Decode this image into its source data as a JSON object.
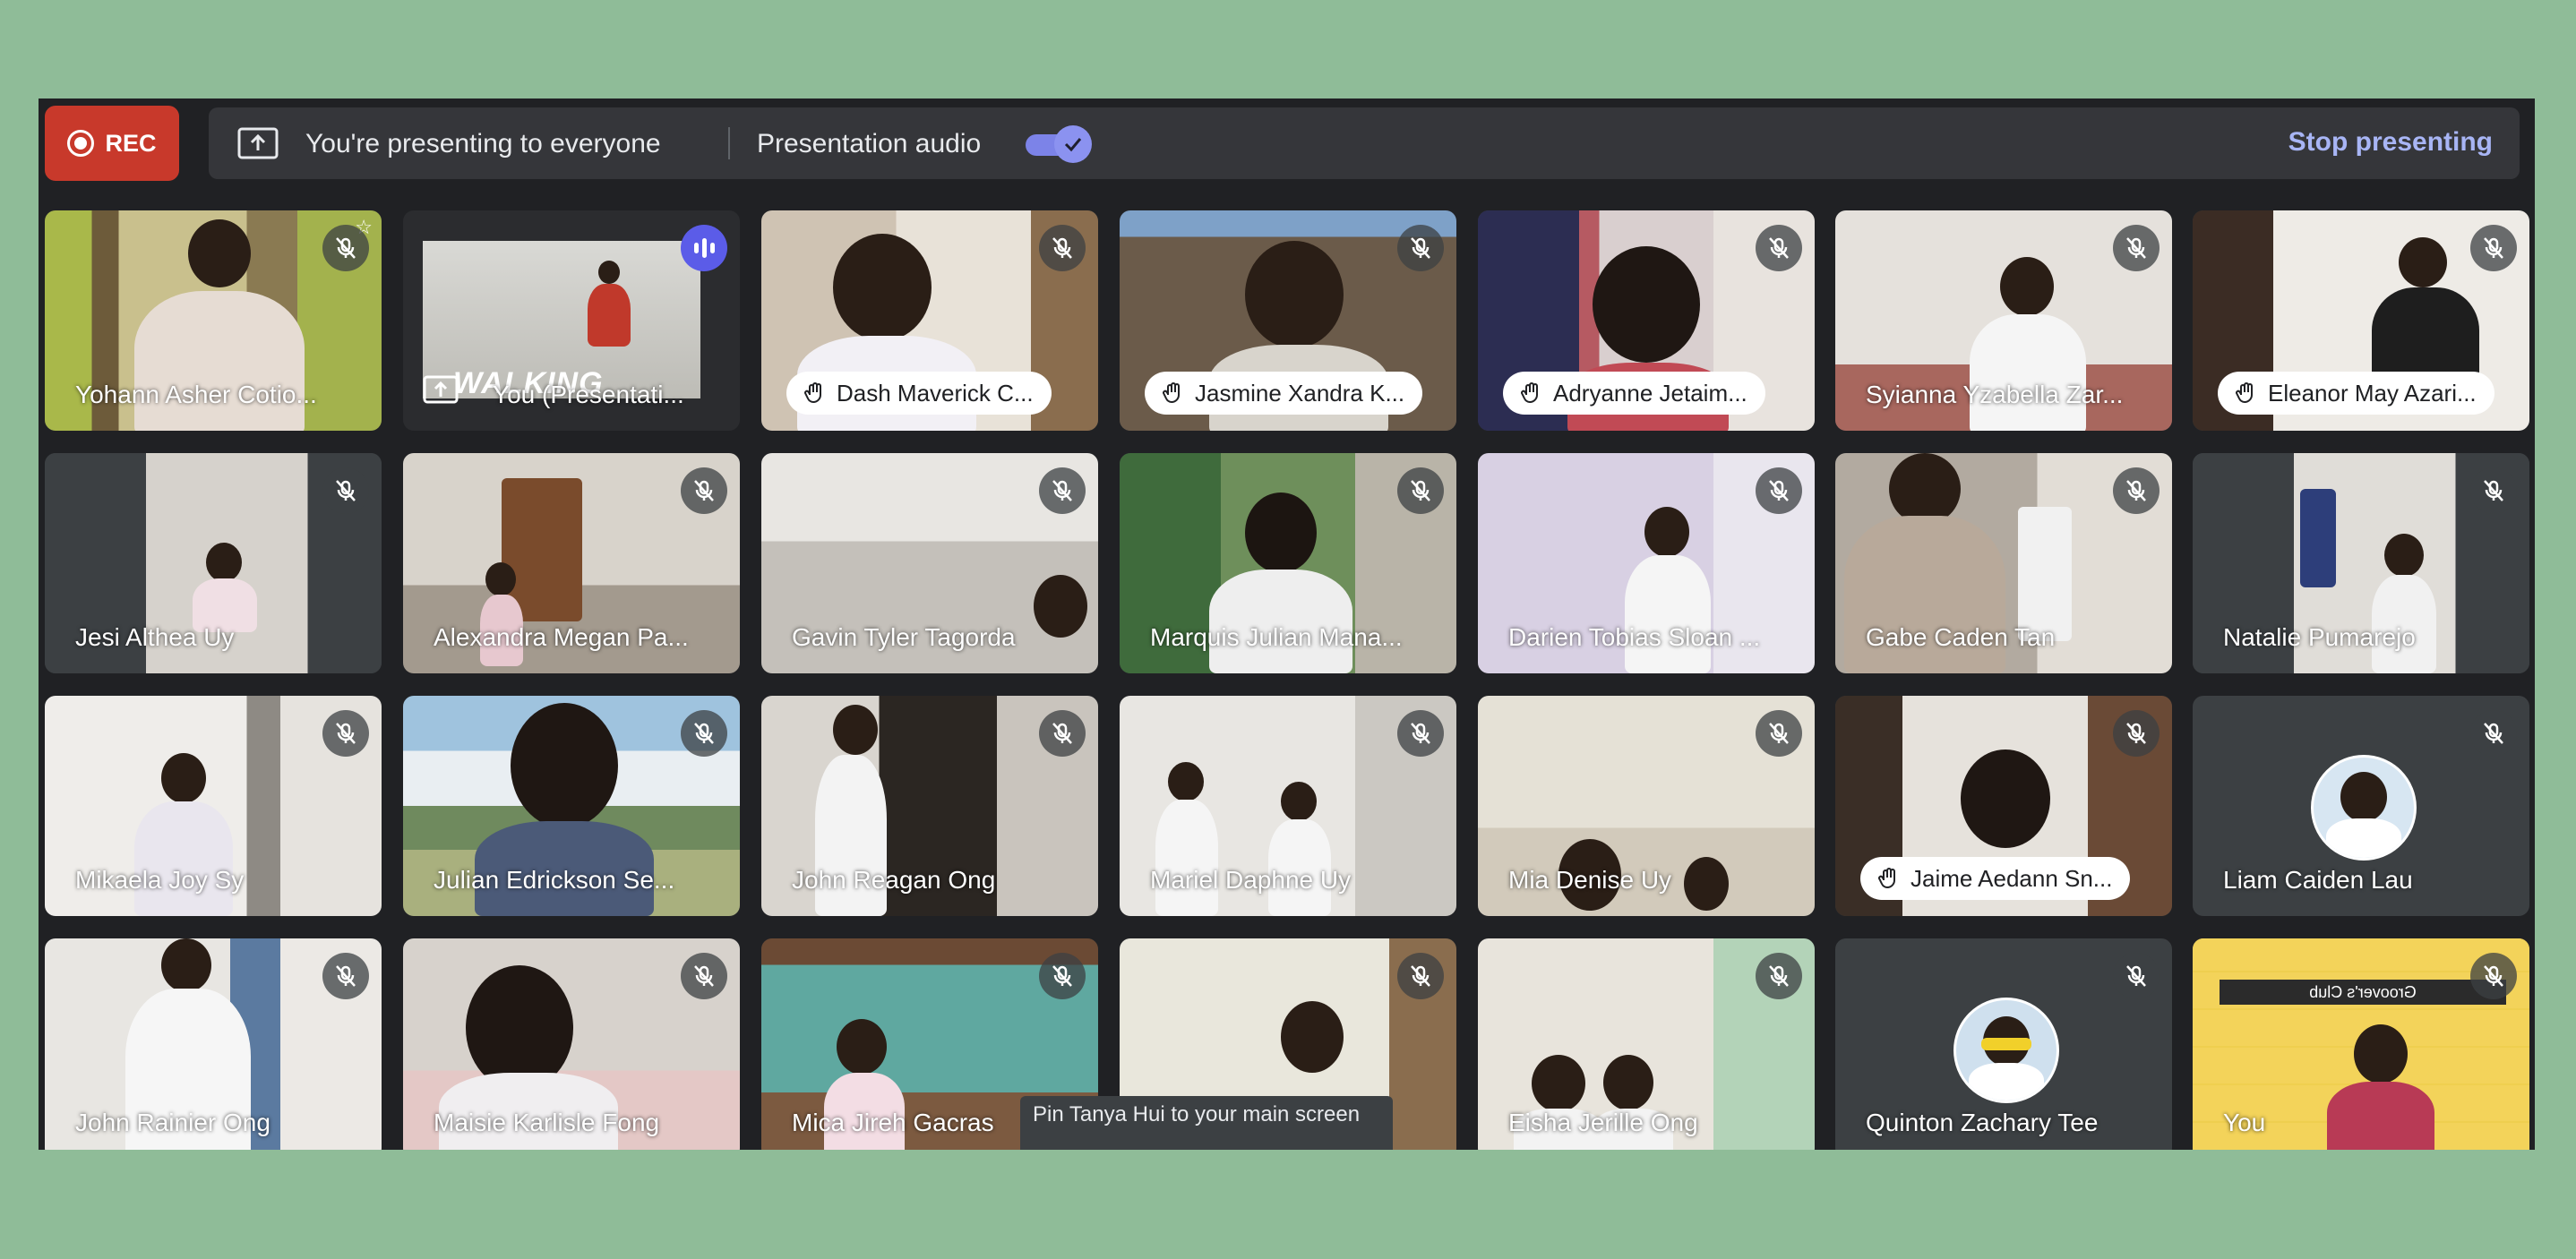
{
  "window": {
    "rec_label": "REC",
    "presenting_text": "You're presenting to everyone",
    "audio_label": "Presentation audio",
    "stop_label": "Stop presenting"
  },
  "tooltip": "Pin Tanya Hui to your main screen",
  "participants": [
    {
      "name": "Yohann Asher Cotio...",
      "style": "text",
      "muted": true
    },
    {
      "name": "You (Presentati...",
      "style": "text",
      "muted": false
    },
    {
      "name": "Dash Maverick C...",
      "style": "pill",
      "muted": true
    },
    {
      "name": "Jasmine Xandra K...",
      "style": "pill",
      "muted": true
    },
    {
      "name": "Adryanne Jetaim...",
      "style": "pill",
      "muted": true
    },
    {
      "name": "Syianna Yzabella Zar...",
      "style": "text",
      "muted": true
    },
    {
      "name": "Eleanor May Azari...",
      "style": "pill",
      "muted": true
    },
    {
      "name": "Jesi Althea Uy",
      "style": "text",
      "muted": true
    },
    {
      "name": "Alexandra Megan Pa...",
      "style": "text",
      "muted": true
    },
    {
      "name": "Gavin Tyler Tagorda",
      "style": "text",
      "muted": true
    },
    {
      "name": "Marquis Julian Mana...",
      "style": "text",
      "muted": true
    },
    {
      "name": "Darien Tobias Sloan ...",
      "style": "text",
      "muted": true
    },
    {
      "name": "Gabe Caden Tan",
      "style": "text",
      "muted": true
    },
    {
      "name": "Natalie Pumarejo",
      "style": "text",
      "muted": true
    },
    {
      "name": "Mikaela Joy Sy",
      "style": "text",
      "muted": true
    },
    {
      "name": "Julian Edrickson Se...",
      "style": "text",
      "muted": true
    },
    {
      "name": "John Reagan Ong",
      "style": "text",
      "muted": true
    },
    {
      "name": "Mariel Daphne Uy",
      "style": "text",
      "muted": true
    },
    {
      "name": "Mia Denise Uy",
      "style": "text",
      "muted": true
    },
    {
      "name": "Jaime Aedann Sn...",
      "style": "pill",
      "muted": true
    },
    {
      "name": "Liam Caiden Lau",
      "style": "text",
      "muted": true
    },
    {
      "name": "John Rainier Ong",
      "style": "text",
      "muted": true
    },
    {
      "name": "Maisie Karlisle Fong",
      "style": "text",
      "muted": true
    },
    {
      "name": "Mica Jireh Gacras",
      "style": "text",
      "muted": true
    },
    {
      "name": "",
      "style": "text",
      "muted": true
    },
    {
      "name": "Eisha Jerille Ong",
      "style": "text",
      "muted": true
    },
    {
      "name": "Quinton Zachary Tee",
      "style": "text",
      "muted": true
    },
    {
      "name": "You",
      "style": "text",
      "muted": true
    }
  ],
  "presentation_overlay": "WALKING",
  "club_banner": "Groover's Club",
  "colors": {
    "background": "#8fbc98",
    "meet_bg": "#202124",
    "rec": "#c8392b",
    "accent": "#8b92f0",
    "stop_link": "#a8b5f5"
  },
  "icons": [
    "record-icon",
    "present-screen-icon",
    "toggle-check-icon",
    "mic-off-icon",
    "raised-hand-icon",
    "speaking-icon"
  ]
}
